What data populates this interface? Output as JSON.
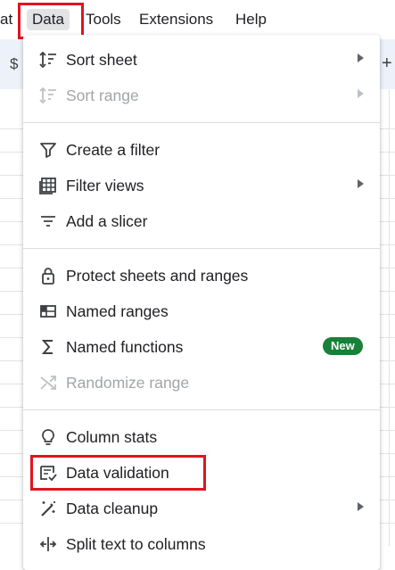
{
  "menubar": {
    "items": [
      {
        "label": "at"
      },
      {
        "label": "Data"
      },
      {
        "label": "Tools"
      },
      {
        "label": "Extensions"
      },
      {
        "label": "Help"
      }
    ]
  },
  "toolbar": {
    "currency_glyph": "$",
    "plus_glyph": "+"
  },
  "menu": {
    "items": [
      {
        "label": "Sort sheet",
        "icon": "sort-icon",
        "submenu": true,
        "disabled": false
      },
      {
        "label": "Sort range",
        "icon": "sort-icon",
        "submenu": true,
        "disabled": true
      },
      {
        "label": "Create a filter",
        "icon": "filter-icon",
        "submenu": false,
        "disabled": false
      },
      {
        "label": "Filter views",
        "icon": "filter-views-icon",
        "submenu": true,
        "disabled": false
      },
      {
        "label": "Add a slicer",
        "icon": "slicer-icon",
        "submenu": false,
        "disabled": false
      },
      {
        "label": "Protect sheets and ranges",
        "icon": "lock-icon",
        "submenu": false,
        "disabled": false
      },
      {
        "label": "Named ranges",
        "icon": "named-ranges-icon",
        "submenu": false,
        "disabled": false
      },
      {
        "label": "Named functions",
        "icon": "sigma-icon",
        "submenu": false,
        "disabled": false,
        "badge": "New"
      },
      {
        "label": "Randomize range",
        "icon": "shuffle-icon",
        "submenu": false,
        "disabled": true
      },
      {
        "label": "Column stats",
        "icon": "lightbulb-icon",
        "submenu": false,
        "disabled": false
      },
      {
        "label": "Data validation",
        "icon": "data-validation-icon",
        "submenu": false,
        "disabled": false
      },
      {
        "label": "Data cleanup",
        "icon": "magic-wand-icon",
        "submenu": true,
        "disabled": false
      },
      {
        "label": "Split text to columns",
        "icon": "split-columns-icon",
        "submenu": false,
        "disabled": false
      }
    ]
  },
  "colors": {
    "highlight": "#e0141e",
    "badge": "#188038",
    "toolbar_bg": "#edf2fa"
  }
}
